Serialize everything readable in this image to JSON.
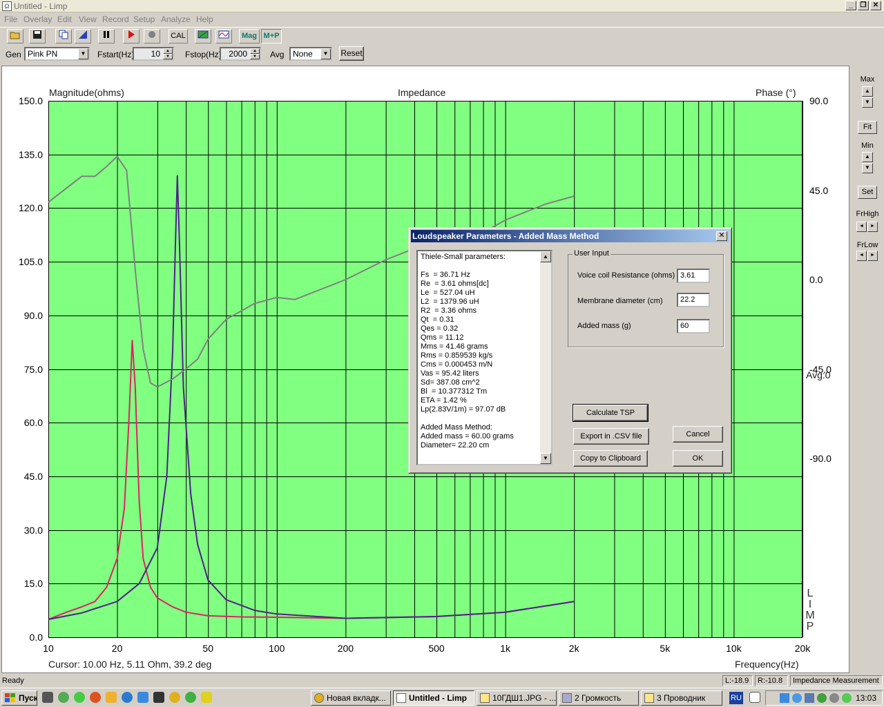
{
  "window": {
    "title": "Untitled - Limp",
    "icon": "app-icon"
  },
  "menu": [
    "File",
    "Overlay",
    "Edit",
    "View",
    "Record",
    "Setup",
    "Analyze",
    "Help"
  ],
  "toolbar": {
    "cal_label": "CAL",
    "mag_label": "Mag",
    "mp_label": "M+P"
  },
  "params": {
    "gen_label": "Gen",
    "gen_value": "Pink PN",
    "fstart_label": "Fstart(Hz)",
    "fstart_value": "10",
    "fstop_label": "Fstop(Hz)",
    "fstop_value": "2000",
    "avg_label": "Avg",
    "avg_value": "None",
    "reset_label": "Reset"
  },
  "plot": {
    "left_axis_title": "Magnitude(ohms)",
    "center_title": "Impedance",
    "right_axis_title": "Phase (°)",
    "x_axis_title": "Frequency(Hz)",
    "avg_text": "Avg:0",
    "cursor_text": "Cursor: 10.00 Hz, 5.11 Ohm, 39.2 deg",
    "watermark": "LIMP",
    "colors": {
      "background": "#80ff80",
      "grid": "#000000",
      "magnitude_added_mass": "#e0206a",
      "magnitude_free_air": "#50208a",
      "phase": "#808080"
    }
  },
  "chart_data": {
    "type": "line",
    "title": "Impedance",
    "xlabel": "Frequency(Hz)",
    "ylabel": "Magnitude(ohms)",
    "y2label": "Phase (°)",
    "xscale": "log",
    "xlim": [
      10,
      20000
    ],
    "ylim": [
      0,
      150
    ],
    "y2lim": [
      -180,
      90
    ],
    "x_ticks": [
      "10",
      "20",
      "50",
      "100",
      "200",
      "500",
      "1k",
      "2k",
      "5k",
      "10k",
      "20k"
    ],
    "x_tick_values": [
      10,
      20,
      50,
      100,
      200,
      500,
      1000,
      2000,
      5000,
      10000,
      20000
    ],
    "y_ticks": [
      "150.0",
      "135.0",
      "120.0",
      "105.0",
      "90.0",
      "75.0",
      "60.0",
      "45.0",
      "30.0",
      "15.0",
      "0.0"
    ],
    "y_tick_values": [
      150,
      135,
      120,
      105,
      90,
      75,
      60,
      45,
      30,
      15,
      0
    ],
    "y2_ticks": [
      "90.0",
      "45.0",
      "0.0",
      "-45.0",
      "-90.0"
    ],
    "y2_tick_values": [
      90,
      45,
      0,
      -45,
      -90
    ],
    "grid": true,
    "series": [
      {
        "color": "#e0206a",
        "axis": "left",
        "x": [
          10,
          12,
          14,
          16,
          18,
          20,
          21.5,
          22.5,
          23.3,
          24,
          25,
          26,
          28,
          30,
          35,
          40,
          50,
          70,
          100,
          200,
          500,
          1000,
          2000
        ],
        "y": [
          5,
          7,
          8.5,
          10,
          14,
          22,
          36,
          60,
          83,
          70,
          38,
          22,
          14,
          11,
          8.5,
          7,
          6,
          5.7,
          5.6,
          5.3,
          5.8,
          7,
          10
        ]
      },
      {
        "color": "#50208a",
        "axis": "left",
        "x": [
          10,
          14,
          20,
          25,
          30,
          33,
          35,
          36,
          36.7,
          37.5,
          39,
          42,
          45,
          50,
          60,
          80,
          100,
          200,
          500,
          1000,
          2000
        ],
        "y": [
          5,
          6.8,
          10,
          15,
          25,
          45,
          80,
          110,
          129,
          110,
          70,
          40,
          26,
          16,
          10.5,
          7.5,
          6.5,
          5.3,
          5.8,
          7,
          10
        ]
      },
      {
        "color": "#808080",
        "axis": "right",
        "x": [
          10,
          12,
          14,
          16,
          18,
          20,
          22,
          24,
          26,
          28,
          30,
          35,
          40,
          45,
          50,
          60,
          80,
          100,
          120,
          200,
          300,
          500,
          700,
          1000,
          1500,
          2000
        ],
        "y": [
          39,
          46,
          52,
          52,
          57,
          62,
          55,
          5,
          -35,
          -52,
          -54,
          -50,
          -45,
          -40,
          -30,
          -20,
          -12,
          -9,
          -10,
          0,
          10,
          20,
          20,
          30,
          38,
          42
        ]
      }
    ]
  },
  "right_panel": {
    "max_label": "Max",
    "fit_label": "Fit",
    "min_label": "Min",
    "set_label": "Set",
    "frhigh_label": "FrHigh",
    "frlow_label": "FrLow"
  },
  "dialog": {
    "title": "Loudspeaker Parameters - Added Mass Method",
    "tsp_lines": [
      "Thiele-Small parameters:",
      "",
      "Fs  = 36.71 Hz",
      "Re  = 3.61 ohms[dc]",
      "Le  = 527.04 uH",
      "L2  = 1379.96 uH",
      "R2  = 3.36 ohms",
      "Qt  = 0.31",
      "Qes = 0.32",
      "Qms = 11.12",
      "Mms = 41.46 grams",
      "Rms = 0.859539 kg/s",
      "Cms = 0.000453 m/N",
      "Vas = 95.42 liters",
      "Sd= 387.08 cm^2",
      "Bl  = 10.377312 Tm",
      "ETA = 1.42 %",
      "Lp(2.83V/1m) = 97.07 dB",
      "",
      "Added Mass Method:",
      "Added mass = 60.00 grams",
      "Diameter= 22.20 cm"
    ],
    "user_input_label": "User Input",
    "voice_coil_label": "Voice coil Resistance (ohms)",
    "voice_coil_value": "3.61",
    "membrane_label": "Membrane diameter (cm)",
    "membrane_value": "22.2",
    "added_mass_label": "Added mass (g)",
    "added_mass_value": "60",
    "calculate_label": "Calculate TSP",
    "export_label": "Export in .CSV file",
    "copy_label": "Copy to Clipboard",
    "cancel_label": "Cancel",
    "ok_label": "OK"
  },
  "status": {
    "ready": "Ready",
    "left_level": "L:-18.9",
    "right_level": "R:-10.8",
    "mode": "Impedance Measurement"
  },
  "taskbar": {
    "start_label": "Пуск",
    "tasks": [
      "Новая вкладк...",
      "Untitled - Limp",
      "10ГДШ1.JPG - ...",
      "2 Громкость",
      "3 Проводник"
    ],
    "lang": "RU",
    "time": "13:03"
  }
}
